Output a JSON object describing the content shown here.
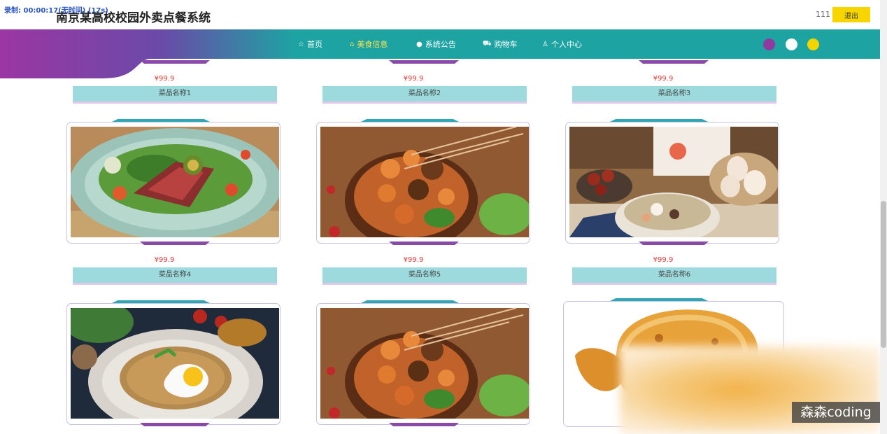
{
  "header": {
    "title": "南京某高校校园外卖点餐系统",
    "recording_overlay": "录制: 00:00:17(无时间) (17s)",
    "username": "111",
    "logout_label": "退出"
  },
  "nav": {
    "items": [
      {
        "label": "首页",
        "icon": "star-icon",
        "active": false
      },
      {
        "label": "美食信息",
        "icon": "bag-icon",
        "active": true
      },
      {
        "label": "系统公告",
        "icon": "dot-icon",
        "active": false
      },
      {
        "label": "购物车",
        "icon": "cart-icon",
        "active": false
      },
      {
        "label": "个人中心",
        "icon": "user-icon",
        "active": false
      }
    ],
    "theme_swatches": [
      "#8e3aa0",
      "#ffffff",
      "#f2d400"
    ],
    "bar_color": "#1ea3a3",
    "accent_color": "#ffe34d"
  },
  "row_top": [
    {
      "price": "¥99.9",
      "name": "菜品名称1"
    },
    {
      "price": "¥99.9",
      "name": "菜品名称2"
    },
    {
      "price": "¥99.9",
      "name": "菜品名称3"
    }
  ],
  "row_middle": [
    {
      "price": "¥99.9",
      "name": "菜品名称4",
      "image": "steak-salad"
    },
    {
      "price": "¥99.9",
      "name": "菜品名称5",
      "image": "grilled-skewers"
    },
    {
      "price": "¥99.9",
      "name": "菜品名称6",
      "image": "soup-with-eggs"
    }
  ],
  "row_bottom": [
    {
      "image": "fried-rice-egg"
    },
    {
      "image": "grilled-skewers"
    },
    {
      "image": "fried-chicken"
    }
  ],
  "watermark": "森森coding"
}
